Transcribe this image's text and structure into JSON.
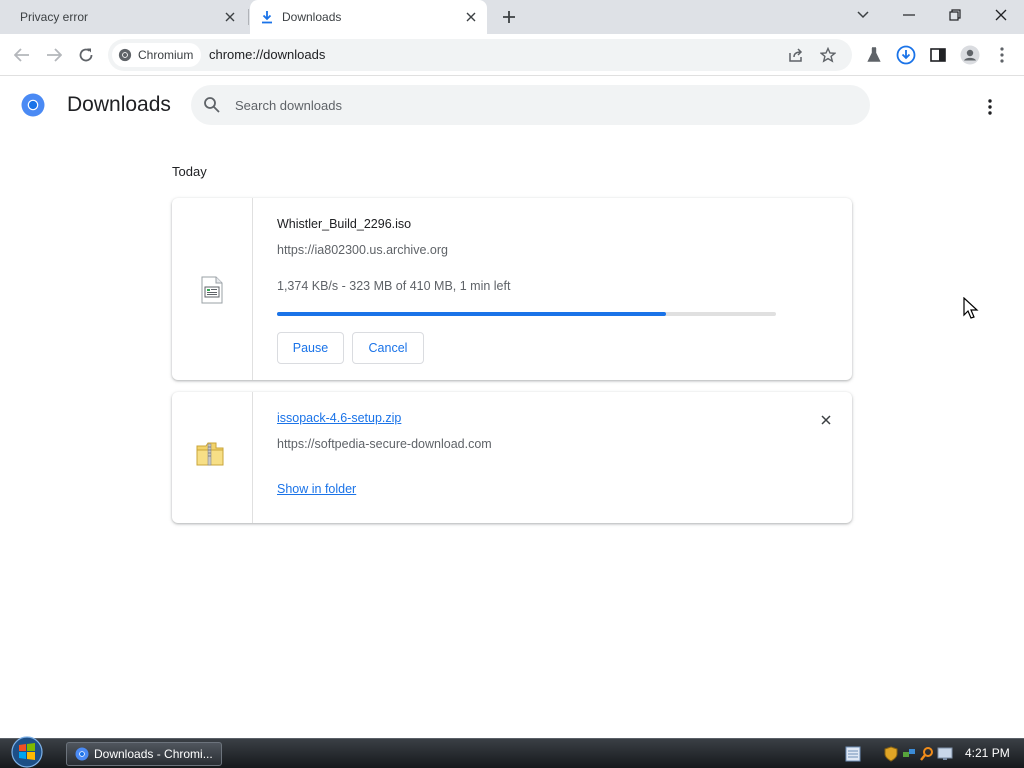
{
  "tabs": [
    {
      "title": "Privacy error",
      "active": false
    },
    {
      "title": "Downloads",
      "active": true
    }
  ],
  "toolbar": {
    "chip_label": "Chromium",
    "url": "chrome://downloads"
  },
  "page": {
    "title": "Downloads",
    "search_placeholder": "Search downloads"
  },
  "downloads": {
    "section_label": "Today",
    "items": [
      {
        "filename": "Whistler_Build_2296.iso",
        "source": "https://ia802300.us.archive.org",
        "status": "1,374 KB/s - 323 MB of 410 MB, 1 min left",
        "progress": 0.78,
        "pause_label": "Pause",
        "cancel_label": "Cancel",
        "icon": "iso-file-icon"
      },
      {
        "filename": "issopack-4.6-setup.zip",
        "source": "https://softpedia-secure-download.com",
        "show_in_folder_label": "Show in folder",
        "icon": "zip-folder-icon"
      }
    ]
  },
  "taskbar": {
    "task_label": "Downloads - Chromi...",
    "clock": "4:21 PM"
  },
  "colors": {
    "accent": "#1a73e8",
    "tabstrip": "#dee1e6"
  }
}
